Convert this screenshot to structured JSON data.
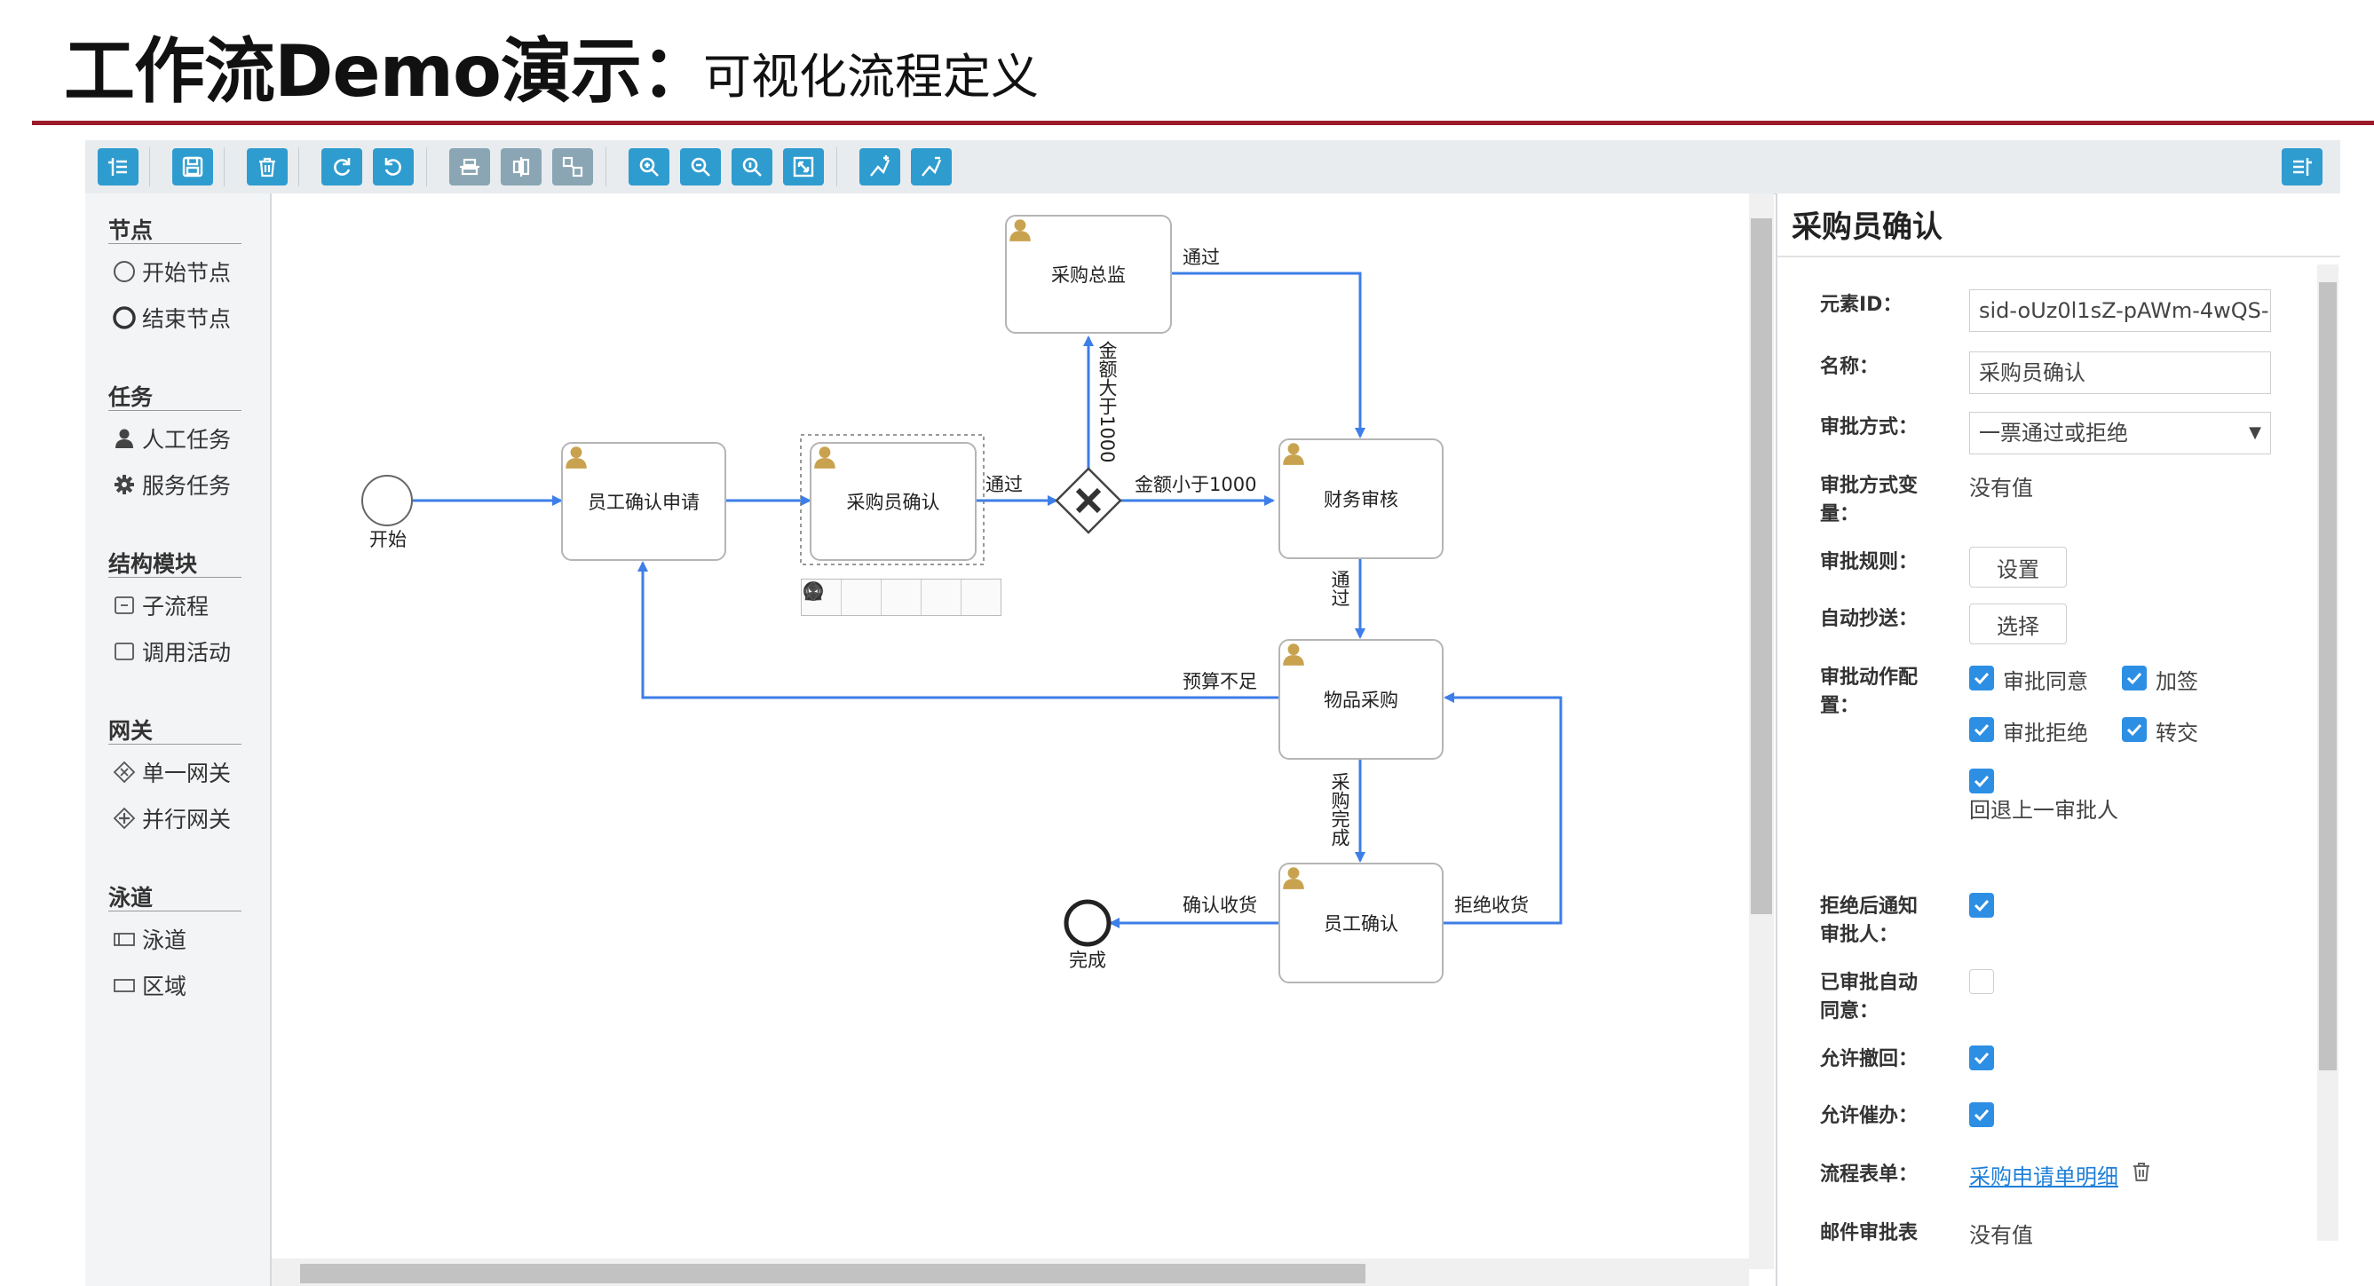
{
  "slide": {
    "title": "工作流Demo演示：",
    "subtitle": "可视化流程定义",
    "accent_color": "#9b1b2a"
  },
  "toolbar": {
    "buttons": [
      {
        "name": "palette-toggle-icon",
        "style": "blue"
      },
      {
        "name": "save-icon",
        "style": "blue"
      },
      {
        "name": "delete-icon",
        "style": "blue"
      },
      {
        "name": "redo-icon",
        "style": "blue"
      },
      {
        "name": "undo-icon",
        "style": "blue"
      },
      {
        "name": "align-vertical-icon",
        "style": "gray"
      },
      {
        "name": "align-horizontal-icon",
        "style": "gray"
      },
      {
        "name": "same-size-icon",
        "style": "gray"
      },
      {
        "name": "zoom-in-icon",
        "style": "blue"
      },
      {
        "name": "zoom-out-icon",
        "style": "blue"
      },
      {
        "name": "zoom-actual-icon",
        "style": "blue"
      },
      {
        "name": "zoom-fit-icon",
        "style": "blue"
      },
      {
        "name": "bend-add-icon",
        "style": "blue"
      },
      {
        "name": "bend-remove-icon",
        "style": "blue"
      }
    ],
    "right_button": "properties-toggle-icon"
  },
  "palette": {
    "groups": [
      {
        "title": "节点",
        "items": [
          {
            "label": "开始节点",
            "icon": "start-event-icon"
          },
          {
            "label": "结束节点",
            "icon": "end-event-icon"
          }
        ]
      },
      {
        "title": "任务",
        "items": [
          {
            "label": "人工任务",
            "icon": "user-task-icon"
          },
          {
            "label": "服务任务",
            "icon": "service-task-icon"
          }
        ]
      },
      {
        "title": "结构模块",
        "items": [
          {
            "label": "子流程",
            "icon": "subprocess-icon"
          },
          {
            "label": "调用活动",
            "icon": "call-activity-icon"
          }
        ]
      },
      {
        "title": "网关",
        "items": [
          {
            "label": "单一网关",
            "icon": "exclusive-gateway-icon"
          },
          {
            "label": "并行网关",
            "icon": "parallel-gateway-icon"
          }
        ]
      },
      {
        "title": "泳道",
        "items": [
          {
            "label": "泳道",
            "icon": "lane-icon"
          },
          {
            "label": "区域",
            "icon": "pool-icon"
          }
        ]
      }
    ]
  },
  "diagram": {
    "start_label": "开始",
    "end_label": "完成",
    "tasks": {
      "t1": "员工确认申请",
      "t2": "采购员确认",
      "t3": "采购总监",
      "t4": "财务审核",
      "t5": "物品采购",
      "t6": "员工确认"
    },
    "flow_labels": {
      "pass1": "通过",
      "amount_gt": "金额大于1000",
      "amount_lt": "金额小于1000",
      "pass2": "通过",
      "pass3": "通过",
      "budget_short": "预算不足",
      "purchase_done": "采购完成",
      "confirm_receipt": "确认收货",
      "reject_receipt": "拒绝收货"
    },
    "flow_color": "#3d7ee8"
  },
  "properties": {
    "title": "采购员确认",
    "fields": {
      "element_id_label": "元素ID：",
      "element_id_value": "sid-oUz0l1sZ-pAWm-4wQS-",
      "name_label": "名称：",
      "name_value": "采购员确认",
      "approve_mode_label": "审批方式：",
      "approve_mode_value": "一票通过或拒绝",
      "approve_var_label": "审批方式变量：",
      "approve_var_value": "没有值",
      "approve_rule_label": "审批规则：",
      "approve_rule_button": "设置",
      "auto_cc_label": "自动抄送：",
      "auto_cc_button": "选择",
      "actions_label": "审批动作配置：",
      "action_agree": "审批同意",
      "action_add": "加签",
      "action_reject": "审批拒绝",
      "action_transfer": "转交",
      "action_back": "回退上一审批人",
      "notify_after_reject_label": "拒绝后通知审批人：",
      "auto_agree_label": "已审批自动同意：",
      "allow_withdraw_label": "允许撤回：",
      "allow_urge_label": "允许催办：",
      "form_label": "流程表单：",
      "form_value": "采购申请单明细",
      "mail_table_label": "邮件审批表",
      "mail_table_value": "没有值"
    },
    "checkbox_color": "#2d8fe4"
  }
}
